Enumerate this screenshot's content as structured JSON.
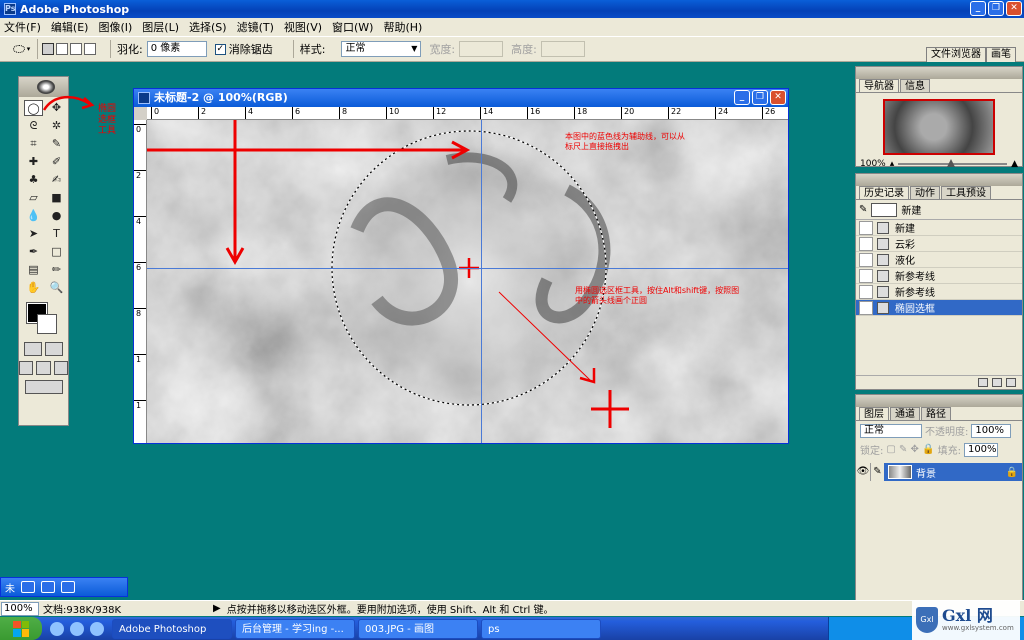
{
  "app": {
    "title": "Adobe Photoshop"
  },
  "menu": [
    "文件(F)",
    "编辑(E)",
    "图像(I)",
    "图层(L)",
    "选择(S)",
    "滤镜(T)",
    "视图(V)",
    "窗口(W)",
    "帮助(H)"
  ],
  "options": {
    "feather_label": "羽化:",
    "feather_value": "0 像素",
    "antialias_label": "消除锯齿",
    "style_label": "样式:",
    "style_value": "正常",
    "width_label": "宽度:",
    "height_label": "高度:",
    "well_tabs": [
      "文件浏览器",
      "画笔"
    ]
  },
  "toolbox": {
    "annotation": "椭圆选框工具",
    "tools": [
      "marquee-ellipse",
      "move",
      "lasso",
      "magic-wand",
      "crop",
      "slice",
      "healing",
      "brush",
      "clone-stamp",
      "history-brush",
      "eraser",
      "gradient",
      "blur",
      "dodge",
      "path-select",
      "type",
      "pen",
      "shape",
      "notes",
      "eyedropper",
      "hand",
      "zoom"
    ],
    "tool_glyphs": [
      "◯",
      "✥",
      "ᘓ",
      "✲",
      "⌗",
      "✎",
      "✚",
      "✐",
      "♣",
      "✍",
      "▱",
      "■",
      "💧",
      "●",
      "➤",
      "T",
      "✒",
      "□",
      "▤",
      "✏",
      "✋",
      "🔍"
    ],
    "colors": {
      "foreground": "#000000",
      "background": "#ffffff"
    }
  },
  "document": {
    "title": "未标题-2 @ 100%(RGB)",
    "ruler_h": [
      "0",
      "2",
      "4",
      "6",
      "8",
      "10",
      "12",
      "14",
      "16",
      "18",
      "20",
      "22",
      "24",
      "26"
    ],
    "ruler_v": [
      "0",
      "2",
      "4",
      "6",
      "8",
      "1",
      "1",
      "1"
    ],
    "annotation_guides": "本图中的蓝色线为辅助线，可以从标尺上直接拖拽出",
    "annotation_select": "用椭圆选区框工具，按住Alt和shift键，按照图中的箭头线画个正圆"
  },
  "navigator": {
    "tabs": [
      "导航器",
      "信息"
    ],
    "zoom": "100%"
  },
  "history": {
    "tabs": [
      "历史记录",
      "动作",
      "工具预设"
    ],
    "snapshot": "新建",
    "items": [
      "新建",
      "云彩",
      "液化",
      "新参考线",
      "新参考线",
      "椭圆选框"
    ],
    "selected_index": 5
  },
  "layers": {
    "tabs": [
      "图层",
      "通道",
      "路径"
    ],
    "blend_mode": "正常",
    "opacity_label": "不透明度:",
    "opacity": "100%",
    "lock_label": "锁定:",
    "fill_label": "填充:",
    "fill": "100%",
    "layer_name": "背景"
  },
  "minimized_doc": {
    "title": "未"
  },
  "status": {
    "zoom": "100%",
    "doc_size": "文档:938K/938K",
    "hint": "点按并拖移以移动选区外框。要用附加选项，使用 Shift、Alt 和 Ctrl 键。"
  },
  "taskbar": {
    "tasks": [
      "Adobe Photoshop",
      "后台管理 - 学习ing -...",
      "003.JPG - 画图",
      "ps"
    ],
    "active_index": 0
  },
  "watermark": {
    "name": "Gxl 网",
    "url": "www.gxlsystem.com",
    "shield": "Gxl"
  }
}
